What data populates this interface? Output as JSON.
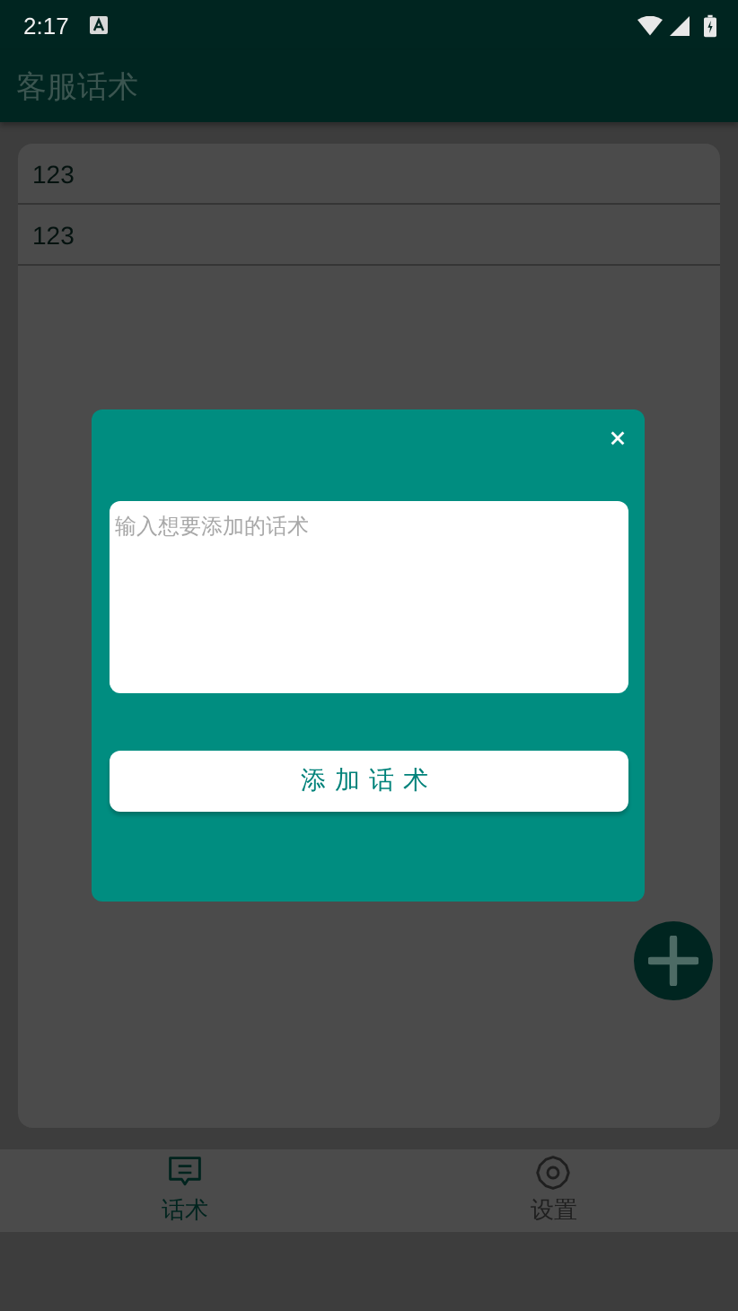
{
  "status_bar": {
    "time": "2:17"
  },
  "app_bar": {
    "title": "客服话术"
  },
  "phrases": [
    {
      "text": "123"
    },
    {
      "text": "123"
    }
  ],
  "dialog": {
    "placeholder": "输入想要添加的话术",
    "button": "添加话术"
  },
  "bottom_nav": [
    {
      "label": "话术",
      "kind": "chat",
      "selected": true
    },
    {
      "label": "设置",
      "kind": "settings",
      "selected": false
    }
  ]
}
